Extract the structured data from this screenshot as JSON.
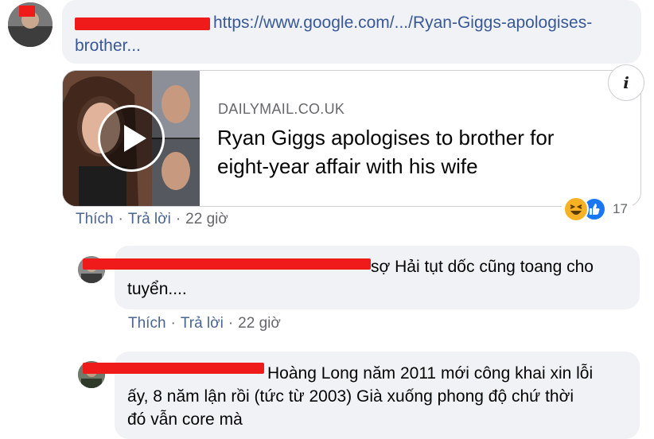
{
  "comment1": {
    "link_text": "https://www.google.com/.../Ryan-Giggs-apologises-",
    "link_text_cont": "brother...",
    "preview": {
      "domain": "DAILYMAIL.CO.UK",
      "headline_line1": "Ryan Giggs apologises to brother for",
      "headline_line2": "eight-year affair with his wife",
      "info_icon_glyph": "i"
    },
    "actions": {
      "like": "Thích",
      "reply": "Trả lời",
      "time": "22 giờ"
    },
    "reactions": {
      "icons": [
        "haha-icon",
        "like-icon"
      ],
      "count": "17"
    }
  },
  "reply1": {
    "text_line1": "sợ Hải tụt dốc cũng toang cho",
    "text_line2": "tuyển....",
    "actions": {
      "like": "Thích",
      "reply": "Trả lời",
      "time": "22 giờ"
    }
  },
  "reply2": {
    "text_line1": "Hoàng Long năm 2011 mới công khai xin lỗi",
    "text_line2": "ấy, 8 năm lận rồi (tức từ 2003) Già xuống phong độ chứ thời",
    "text_line3": "đó vẫn core mà"
  },
  "colors": {
    "bubble": "#f0f2f5",
    "link": "#385898",
    "action": "#4b6591",
    "redaction": "#ef1b1b"
  }
}
